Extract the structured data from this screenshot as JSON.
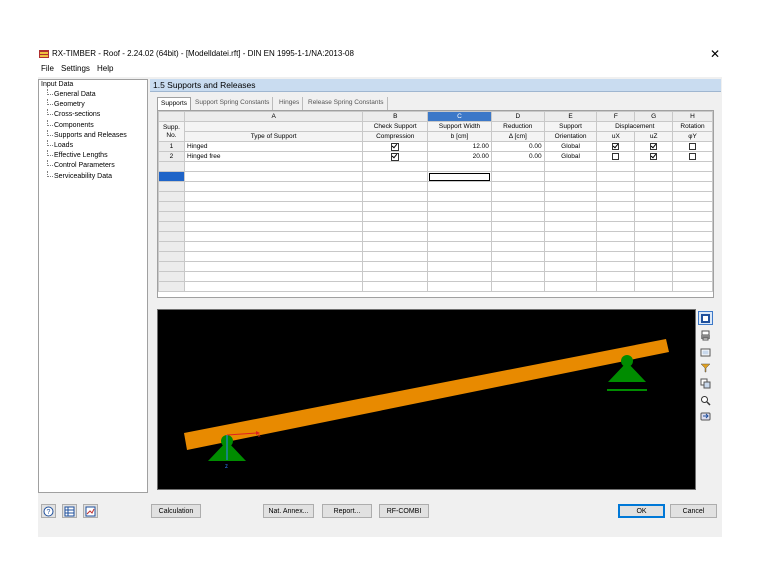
{
  "window": {
    "title": "RX-TIMBER - Roof - 2.24.02 (64bit) - [Modelldatei.rft] - DIN EN 1995-1-1/NA:2013-08",
    "close_glyph": "✕"
  },
  "menu": [
    "File",
    "Settings",
    "Help"
  ],
  "nav": {
    "root": "Input Data",
    "items": [
      "General Data",
      "Geometry",
      "Cross-sections",
      "Components",
      "Supports and Releases",
      "Loads",
      "Effective Lengths",
      "Control Parameters",
      "Serviceability Data"
    ]
  },
  "section": {
    "title": "1.5 Supports and Releases"
  },
  "tabs": [
    "Supports",
    "Support Spring Constants",
    "Hinges",
    "Release Spring Constants"
  ],
  "table": {
    "col_letters": [
      "A",
      "B",
      "C",
      "D",
      "E",
      "F",
      "G",
      "H"
    ],
    "supp_header": [
      "Supp.",
      "No."
    ],
    "headers": [
      [
        "",
        "Type of Support"
      ],
      [
        "Check Support",
        "Compression"
      ],
      [
        "Support Width",
        "b [cm]"
      ],
      [
        "Reduction",
        "Δ [cm]"
      ],
      [
        "Support",
        "Orientation"
      ],
      [
        "",
        "uX"
      ],
      [
        "",
        "uZ"
      ],
      [
        "Rotation",
        "φY"
      ]
    ],
    "displacement_label": "Displacement",
    "rows": [
      {
        "no": "1",
        "type": "Hinged",
        "check": true,
        "width": "12.00",
        "reduction": "0.00",
        "orientation": "Global",
        "ux": true,
        "uz": true,
        "phi": false
      },
      {
        "no": "2",
        "type": "Hinged free",
        "check": true,
        "width": "20.00",
        "reduction": "0.00",
        "orientation": "Global",
        "ux": false,
        "uz": true,
        "phi": false
      }
    ],
    "empty_rows": 13
  },
  "graphic": {
    "beam_color": "#e88a00",
    "support_color": "#008c00",
    "axis_x_label": "x",
    "axis_z_label": "z"
  },
  "right_toolbar_icons": [
    "view-settings-icon",
    "print-icon",
    "display-icon",
    "filter-icon",
    "views-icon",
    "zoom-icon",
    "export-icon"
  ],
  "bottom_icons": [
    "help-icon",
    "table-icon",
    "graphic-icon"
  ],
  "buttons": {
    "calculation": "Calculation",
    "nat_annex": "Nat. Annex...",
    "report": "Report...",
    "rf_combi": "RF-COMBI",
    "ok": "OK",
    "cancel": "Cancel"
  }
}
